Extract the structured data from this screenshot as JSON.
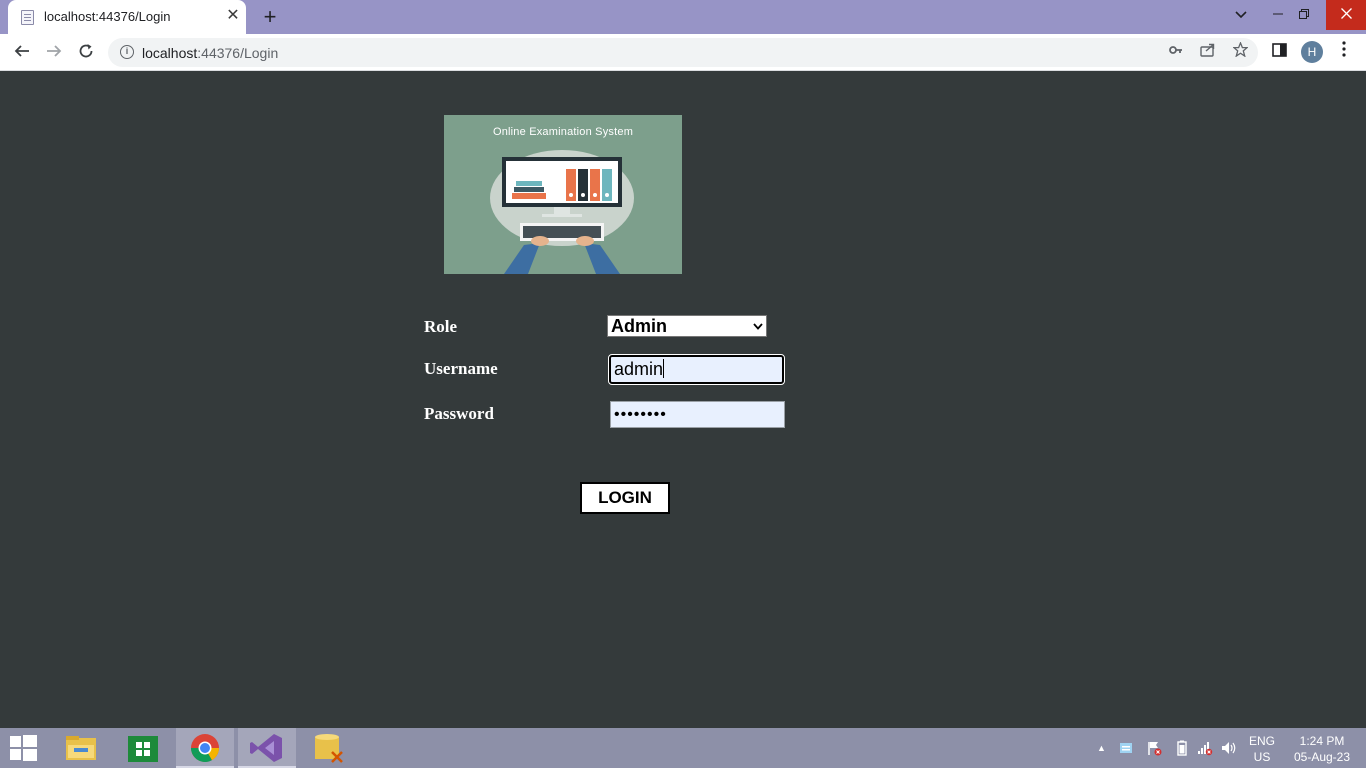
{
  "browser": {
    "tab_title": "localhost:44376/Login",
    "url_host": "localhost",
    "url_path": ":44376/Login",
    "profile_initial": "H"
  },
  "login": {
    "logo_title": "Online Examination System",
    "role_label": "Role",
    "role_selected": "Admin",
    "username_label": "Username",
    "username_value": "admin",
    "password_label": "Password",
    "password_masked": "••••••••",
    "login_button": "LOGIN"
  },
  "taskbar": {
    "language": "ENG",
    "region": "US",
    "time": "1:24 PM",
    "date": "05-Aug-23"
  },
  "icons": [
    "back-icon",
    "forward-icon",
    "reload-icon",
    "info-icon",
    "key-icon",
    "share-icon",
    "star-icon",
    "side-panel-icon",
    "menu-icon"
  ],
  "colors": {
    "titlebar": "#9794c6",
    "page_background": "#343a3b",
    "logo_background": "#7d9f8c",
    "input_autofill": "#e8f0fe",
    "taskbar": "#8d90a8"
  }
}
